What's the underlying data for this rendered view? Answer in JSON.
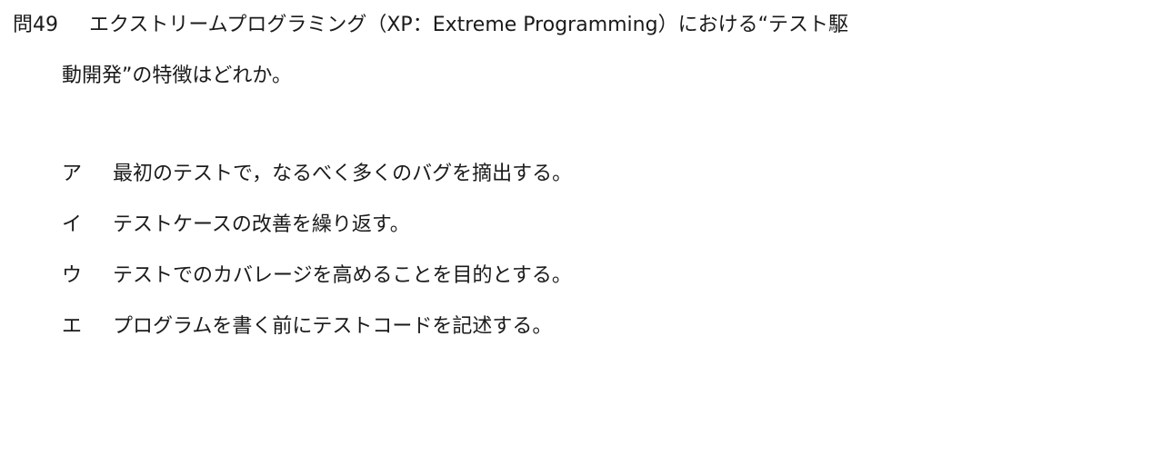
{
  "question": {
    "number": "問49",
    "text_line1": "エクストリームプログラミング（XP：Extreme Programming）における“テスト駆",
    "text_line2": "動開発”の特徴はどれか。"
  },
  "choices": [
    {
      "label": "ア",
      "text": "最初のテストで，なるべく多くのバグを摘出する。"
    },
    {
      "label": "イ",
      "text": "テストケースの改善を繰り返す。"
    },
    {
      "label": "ウ",
      "text": "テストでのカバレージを高めることを目的とする。"
    },
    {
      "label": "エ",
      "text": "プログラムを書く前にテストコードを記述する。"
    }
  ]
}
